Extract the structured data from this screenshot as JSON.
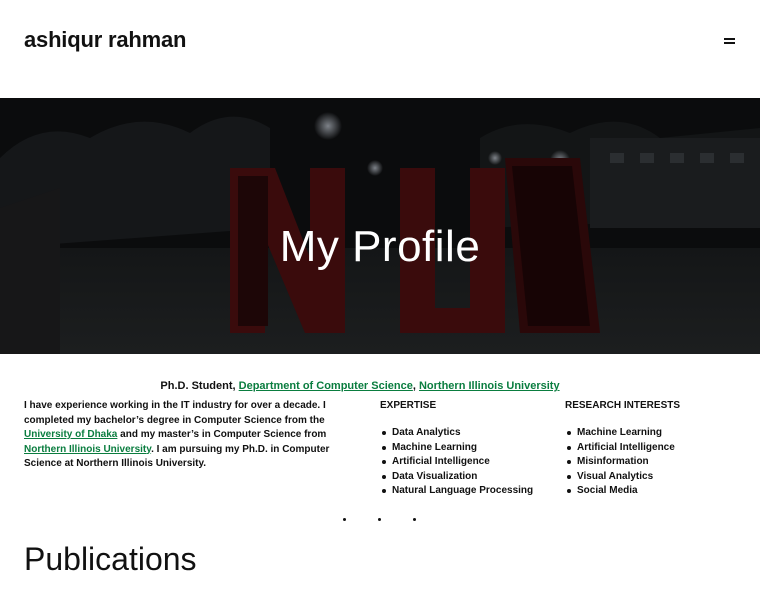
{
  "header": {
    "site_title": "ashiqur rahman"
  },
  "hero": {
    "title": "My Profile"
  },
  "role": {
    "prefix": "Ph.D. Student,",
    "department_link": "Department of Computer Science",
    "separator": ",",
    "university_link": "Northern Illinois University"
  },
  "about": {
    "part1": "I have experience working in the IT industry for over a decade. I completed my bachelor’s degree in Computer Science from the ",
    "link1": "University of Dhaka",
    "part2": " and my master’s in Computer Science from ",
    "link2": "Northern Illinois University",
    "part3": ". I am pursuing my Ph.D. in Computer Science at Northern Illinois University."
  },
  "expertise": {
    "heading": "EXPERTISE",
    "items": [
      "Data Analytics",
      "Machine Learning",
      "Artificial Intelligence",
      "Data Visualization",
      "Natural Language Processing"
    ]
  },
  "research": {
    "heading": "RESEARCH INTERESTS",
    "items": [
      "Machine Learning",
      "Artificial Intelligence",
      "Misinformation",
      "Visual Analytics",
      "Social Media"
    ]
  },
  "publications": {
    "heading": "Publications"
  },
  "colors": {
    "link": "#0a7d3f",
    "hero_bg": "#0a0b0c",
    "text": "#111111"
  },
  "icons": {
    "menu": "hamburger-menu-icon"
  }
}
